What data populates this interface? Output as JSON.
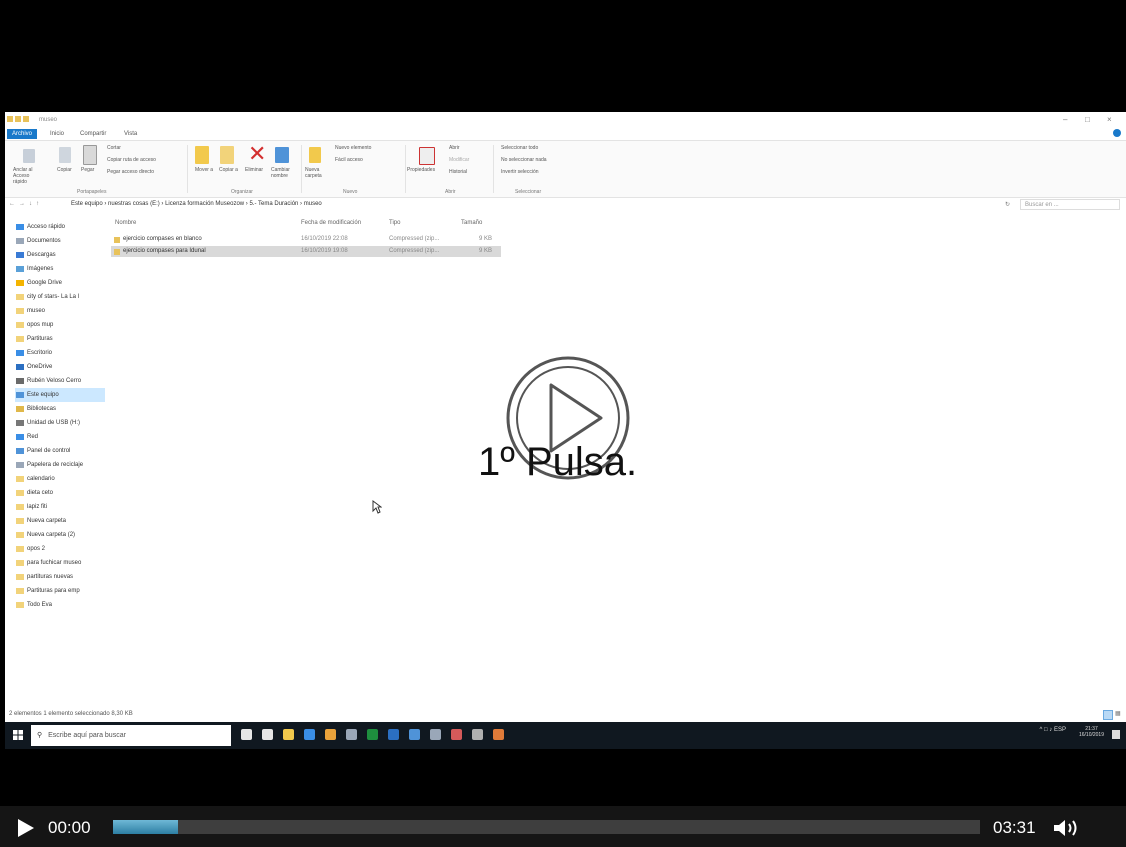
{
  "explorer": {
    "window_title": "museo",
    "tabs": [
      "Archivo",
      "Inicio",
      "Compartir",
      "Vista"
    ],
    "ribbon": {
      "clipboard": {
        "pin_label": "Anclar al Acceso rápido",
        "copy_label": "Copiar",
        "paste_label": "Pegar",
        "cut_label": "Cortar",
        "copy_path_label": "Copiar ruta de acceso",
        "paste_shortcut_label": "Pegar acceso directo",
        "group_label": "Portapapeles"
      },
      "organize": {
        "move_label": "Mover a",
        "copyto_label": "Copiar a",
        "delete_label": "Eliminar",
        "rename_label": "Cambiar nombre",
        "group_label": "Organizar"
      },
      "new": {
        "new_folder_label": "Nueva carpeta",
        "new_item_label": "Nuevo elemento",
        "easy_access_label": "Fácil acceso",
        "group_label": "Nuevo"
      },
      "open": {
        "properties_label": "Propiedades",
        "open_label": "Abrir",
        "edit_label": "Modificar",
        "history_label": "Historial",
        "group_label": "Abrir"
      },
      "select": {
        "select_all_label": "Seleccionar todo",
        "select_none_label": "No seleccionar nada",
        "invert_label": "Invertir selección",
        "group_label": "Seleccionar"
      }
    },
    "breadcrumb": [
      "Este equipo",
      "nuestras cosas (E:)",
      "Licenza formación Museozow",
      "5.- Tema Duración",
      "museo"
    ],
    "search_placeholder": "Buscar en ...",
    "nav_items": [
      {
        "label": "Acceso rápido",
        "color": "#3a8ee6"
      },
      {
        "label": "Documentos",
        "color": "#9aa7b8"
      },
      {
        "label": "Descargas",
        "color": "#3a7bd5"
      },
      {
        "label": "Imágenes",
        "color": "#5aa0d8"
      },
      {
        "label": "Google Drive",
        "color": "#f4b400"
      },
      {
        "label": "city of stars- La La l",
        "color": "#f2d37a"
      },
      {
        "label": "museo",
        "color": "#f2d37a"
      },
      {
        "label": "opos mup",
        "color": "#f2d37a"
      },
      {
        "label": "Partituras",
        "color": "#f2d37a"
      },
      {
        "label": "Escritorio",
        "color": "#3a8ee6"
      },
      {
        "label": "OneDrive",
        "color": "#2b6fc2"
      },
      {
        "label": "Rubén Veloso Cerro",
        "color": "#6a6a6a"
      },
      {
        "label": "Este equipo",
        "color": "#4f93d8"
      },
      {
        "label": "Bibliotecas",
        "color": "#e0b84a"
      },
      {
        "label": "Unidad de USB (H:)",
        "color": "#777"
      },
      {
        "label": "Red",
        "color": "#3a8ee6"
      },
      {
        "label": "Panel de control",
        "color": "#4f93d8"
      },
      {
        "label": "Papelera de reciclaje",
        "color": "#9aa7b8"
      },
      {
        "label": "calendario",
        "color": "#f2d37a"
      },
      {
        "label": "dieta ceto",
        "color": "#f2d37a"
      },
      {
        "label": "lapiz fiti",
        "color": "#f2d37a"
      },
      {
        "label": "Nueva carpeta",
        "color": "#f2d37a"
      },
      {
        "label": "Nueva carpeta (2)",
        "color": "#f2d37a"
      },
      {
        "label": "opos 2",
        "color": "#f2d37a"
      },
      {
        "label": "para fuchicar museo",
        "color": "#f2d37a"
      },
      {
        "label": "partituras nuevas",
        "color": "#f2d37a"
      },
      {
        "label": "Partituras para emp",
        "color": "#f2d37a"
      },
      {
        "label": "Todo Eva",
        "color": "#f2d37a"
      }
    ],
    "columns": {
      "name": "Nombre",
      "modified": "Fecha de modificación",
      "type": "Tipo",
      "size": "Tamaño"
    },
    "files": [
      {
        "name": "ejercicio compases en blanco",
        "modified": "16/10/2019 22:08",
        "type": "Compressed (zip...",
        "size": "9 KB"
      },
      {
        "name": "ejercicio compases para Idunal",
        "modified": "16/10/2019 19:08",
        "type": "Compressed (zip...",
        "size": "9 KB"
      }
    ],
    "status": "2 elementos    1 elemento seleccionado  8,30 KB"
  },
  "taskbar": {
    "search_placeholder": "Escribe aquí para buscar",
    "apps": [
      {
        "name": "cortana-icon",
        "color": "#e6e6e6"
      },
      {
        "name": "task-view-icon",
        "color": "#e6e6e6"
      },
      {
        "name": "file-explorer-icon",
        "color": "#f2c94c"
      },
      {
        "name": "edge-icon",
        "color": "#3a8ee6"
      },
      {
        "name": "chrome-icon",
        "color": "#e9a23b"
      },
      {
        "name": "calculator-icon",
        "color": "#9aa7b8"
      },
      {
        "name": "excel-icon",
        "color": "#1e8e3e"
      },
      {
        "name": "word-icon",
        "color": "#2b6fc2"
      },
      {
        "name": "mail-icon",
        "color": "#4f93d8"
      },
      {
        "name": "store-icon",
        "color": "#9aa7b8"
      },
      {
        "name": "app-icon",
        "color": "#d65a5a"
      },
      {
        "name": "app-icon-2",
        "color": "#b0b0b0"
      },
      {
        "name": "media-icon",
        "color": "#e07b39"
      }
    ],
    "lang": "ESP",
    "time": "21:37",
    "date": "16/10/2019"
  },
  "overlay": {
    "caption": "1º Pulsa."
  },
  "player": {
    "current_time": "00:00",
    "duration": "03:31",
    "progress_fraction": 0.075
  }
}
